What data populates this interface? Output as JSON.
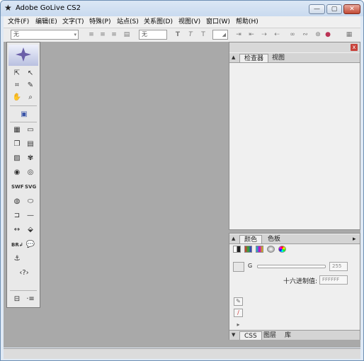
{
  "window": {
    "title": "Adobe GoLive CS2",
    "minimize": "—",
    "maximize": "▢",
    "close": "✕"
  },
  "menu": [
    {
      "label": "文件(F)"
    },
    {
      "label": "编辑(E)"
    },
    {
      "label": "文字(T)"
    },
    {
      "label": "特殊(P)"
    },
    {
      "label": "站点(S)"
    },
    {
      "label": "关系图(D)"
    },
    {
      "label": "视图(V)"
    },
    {
      "label": "窗口(W)"
    },
    {
      "label": "帮助(H)"
    }
  ],
  "toolbar": {
    "style_select": "无",
    "size_select": "无",
    "style_arrow": "▾",
    "size_arrow": "◢"
  },
  "toolbox": {
    "logo": "GoLive",
    "bottom_left": "⊟",
    "bottom_right": "·≡"
  },
  "inspector": {
    "close": "x",
    "collapse": "▲",
    "tabs": [
      {
        "label": "检查器"
      },
      {
        "label": "视图"
      }
    ]
  },
  "color_panel": {
    "collapse": "▲",
    "tabs": [
      {
        "label": "颜色"
      },
      {
        "label": "色板"
      }
    ],
    "menu_button": "▸",
    "channel_label": "G",
    "channel_value": "255",
    "hex_label": "十六进制值:",
    "hex_value": "FFFFFF"
  },
  "bottom_tabs": [
    {
      "label": "CSS"
    },
    {
      "label": "图层"
    },
    {
      "label": "库"
    }
  ],
  "bottom_collapse": "▼",
  "colors": {
    "workspace": "#a9a9a9",
    "panel": "#f0f0f0",
    "titlebar": "#c9daef"
  }
}
